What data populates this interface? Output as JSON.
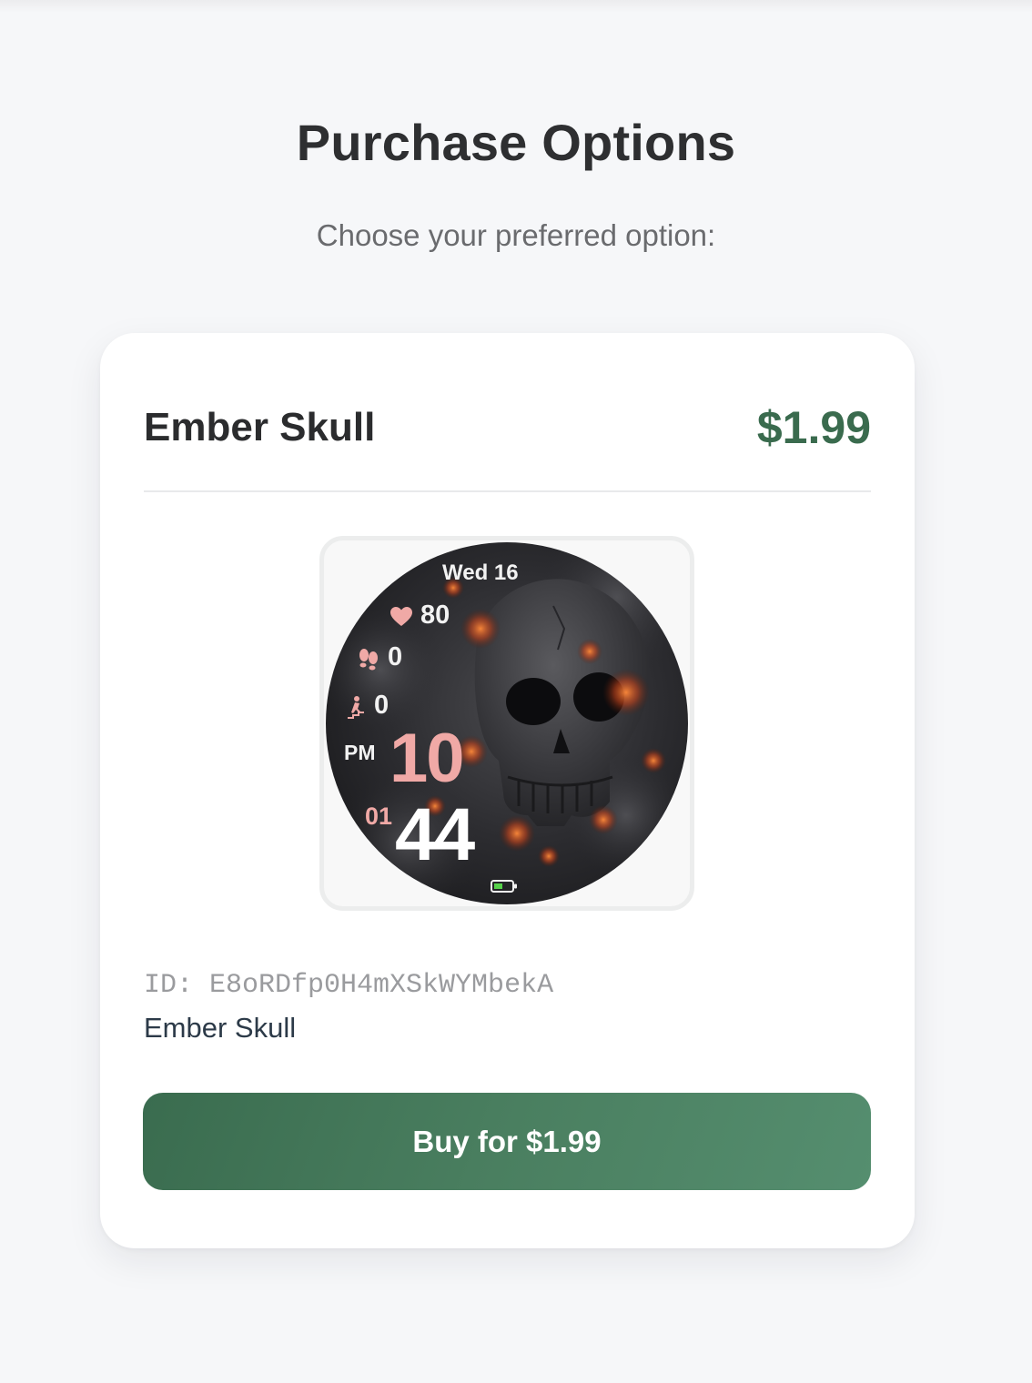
{
  "page": {
    "title": "Purchase Options",
    "subtitle": "Choose your preferred option:"
  },
  "product": {
    "name": "Ember Skull",
    "price": "$1.99",
    "id_line": "ID: E8oRDfp0H4mXSkWYMbekA",
    "description_name": "Ember Skull",
    "buy_label": "Buy for $1.99"
  },
  "watch_face": {
    "date": "Wed 16",
    "heart_rate": "80",
    "steps": "0",
    "floors": "0",
    "ampm": "PM",
    "hour": "10",
    "seconds": "01",
    "minutes": "44",
    "icons": [
      "heart-icon",
      "footsteps-icon",
      "stairs-icon",
      "battery-icon"
    ]
  },
  "colors": {
    "accent": "#3a6b4e",
    "button_start": "#3a6c4f",
    "button_end": "#558e6f",
    "hour_pink": "#f0a9a6",
    "background": "#f6f7f9"
  }
}
